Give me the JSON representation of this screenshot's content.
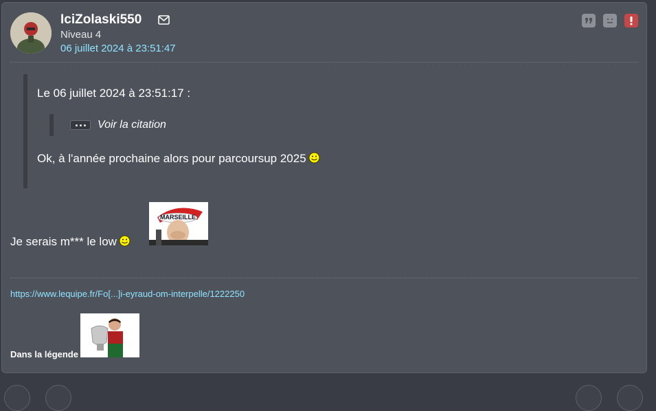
{
  "post": {
    "username": "IciZolaski550",
    "level": "Niveau 4",
    "date": "06 juillet 2024 à 23:51:47",
    "icons": {
      "mail": "mail-icon",
      "quote": "quote-icon",
      "sad": "sad-face-icon",
      "report": "report-icon"
    },
    "quote": {
      "header": "Le 06 juillet 2024 à 23:51:17 :",
      "nested_label": "Voir la citation",
      "text": "Ok, à l'année prochaine alors pour parcoursup 2025"
    },
    "message": "Je serais m*** le low",
    "sticker_caption": "MARSEILLE",
    "signature": {
      "link": "https://www.lequipe.fr/Fo[...]i-eyraud-om-interpelle/1222250",
      "text": "Dans la légende"
    }
  },
  "colors": {
    "card_bg": "#4e525b",
    "page_bg": "#393c44",
    "link": "#8fe4ff",
    "alert": "#c64747",
    "icon_gray": "#8d9097"
  }
}
